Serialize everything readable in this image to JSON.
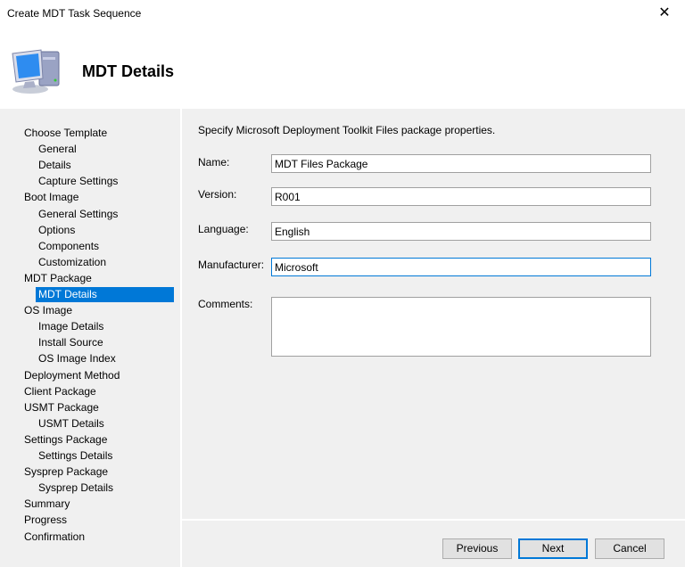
{
  "window": {
    "title": "Create MDT Task Sequence",
    "close_icon": "✕"
  },
  "header": {
    "title": "MDT Details",
    "icon": "computer-icon"
  },
  "nav": {
    "items": [
      {
        "label": "Choose Template",
        "indent": 0
      },
      {
        "label": "General",
        "indent": 1
      },
      {
        "label": "Details",
        "indent": 1
      },
      {
        "label": "Capture Settings",
        "indent": 1
      },
      {
        "label": "Boot Image",
        "indent": 0
      },
      {
        "label": "General Settings",
        "indent": 1
      },
      {
        "label": "Options",
        "indent": 1
      },
      {
        "label": "Components",
        "indent": 1
      },
      {
        "label": "Customization",
        "indent": 1
      },
      {
        "label": "MDT Package",
        "indent": 0
      },
      {
        "label": "MDT Details",
        "indent": 1,
        "selected": true
      },
      {
        "label": "OS Image",
        "indent": 0
      },
      {
        "label": "Image Details",
        "indent": 1
      },
      {
        "label": "Install Source",
        "indent": 1
      },
      {
        "label": "OS Image Index",
        "indent": 1
      },
      {
        "label": "Deployment Method",
        "indent": 0
      },
      {
        "label": "Client Package",
        "indent": 0
      },
      {
        "label": "USMT Package",
        "indent": 0
      },
      {
        "label": "USMT Details",
        "indent": 1
      },
      {
        "label": "Settings Package",
        "indent": 0
      },
      {
        "label": "Settings Details",
        "indent": 1
      },
      {
        "label": "Sysprep Package",
        "indent": 0
      },
      {
        "label": "Sysprep Details",
        "indent": 1
      },
      {
        "label": "Summary",
        "indent": 0
      },
      {
        "label": "Progress",
        "indent": 0
      },
      {
        "label": "Confirmation",
        "indent": 0
      }
    ],
    "selected_color": "#0078d7"
  },
  "main": {
    "description": "Specify Microsoft Deployment Toolkit Files package properties.",
    "name": {
      "label": "Name:",
      "value": "MDT Files Package"
    },
    "version": {
      "label": "Version:",
      "value": "R001"
    },
    "language": {
      "label": "Language:",
      "value": "English"
    },
    "manufacturer": {
      "label": "Manufacturer:",
      "value": "Microsoft"
    },
    "comments": {
      "label": "Comments:",
      "value": ""
    }
  },
  "footer": {
    "previous": "Previous",
    "next": "Next",
    "cancel": "Cancel"
  }
}
